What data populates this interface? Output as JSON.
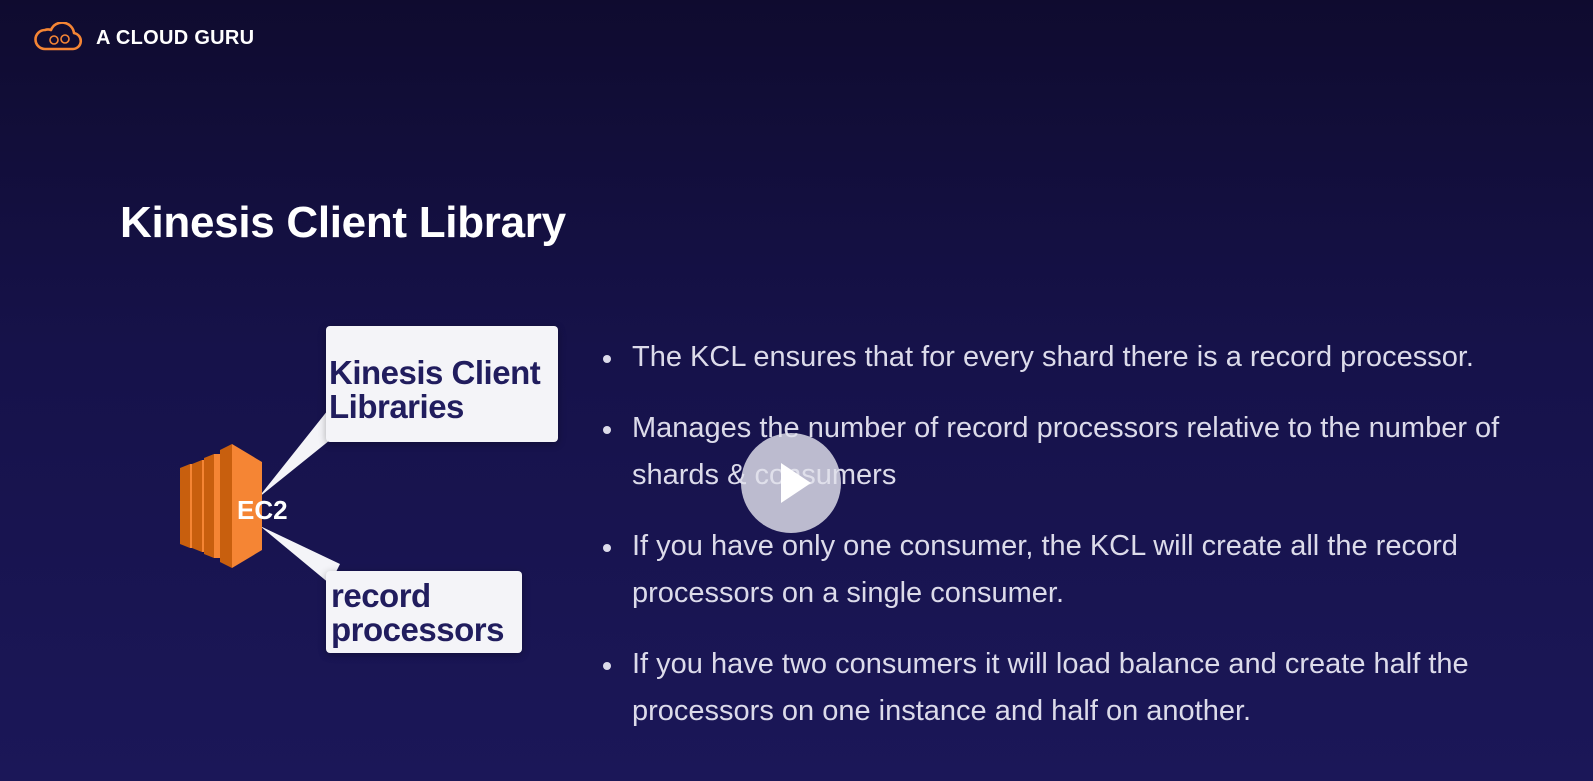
{
  "brand": {
    "name": "A CLOUD GURU",
    "logo_icon": "cloud-logo-icon",
    "accent_color": "#f58534"
  },
  "slide": {
    "title": "Kinesis Client Library",
    "diagram": {
      "instance_label": "EC2",
      "instance_icon": "ec2-icon",
      "callout_top": "Kinesis Client Libraries",
      "callout_bottom": "record processors"
    },
    "bullets": [
      "The KCL ensures that for every shard there is a record processor.",
      "Manages the number of record processors relative to the number of shards & consumers",
      "If you have only one consumer, the KCL will create all the record processors on a single consumer.",
      "If you have two consumers it will load balance and create half the processors on one instance and half on another."
    ]
  },
  "player": {
    "play_icon": "play-icon"
  },
  "colors": {
    "background": "#16124a",
    "callout_text": "#211d5e",
    "ec2_orange": "#f58534"
  }
}
